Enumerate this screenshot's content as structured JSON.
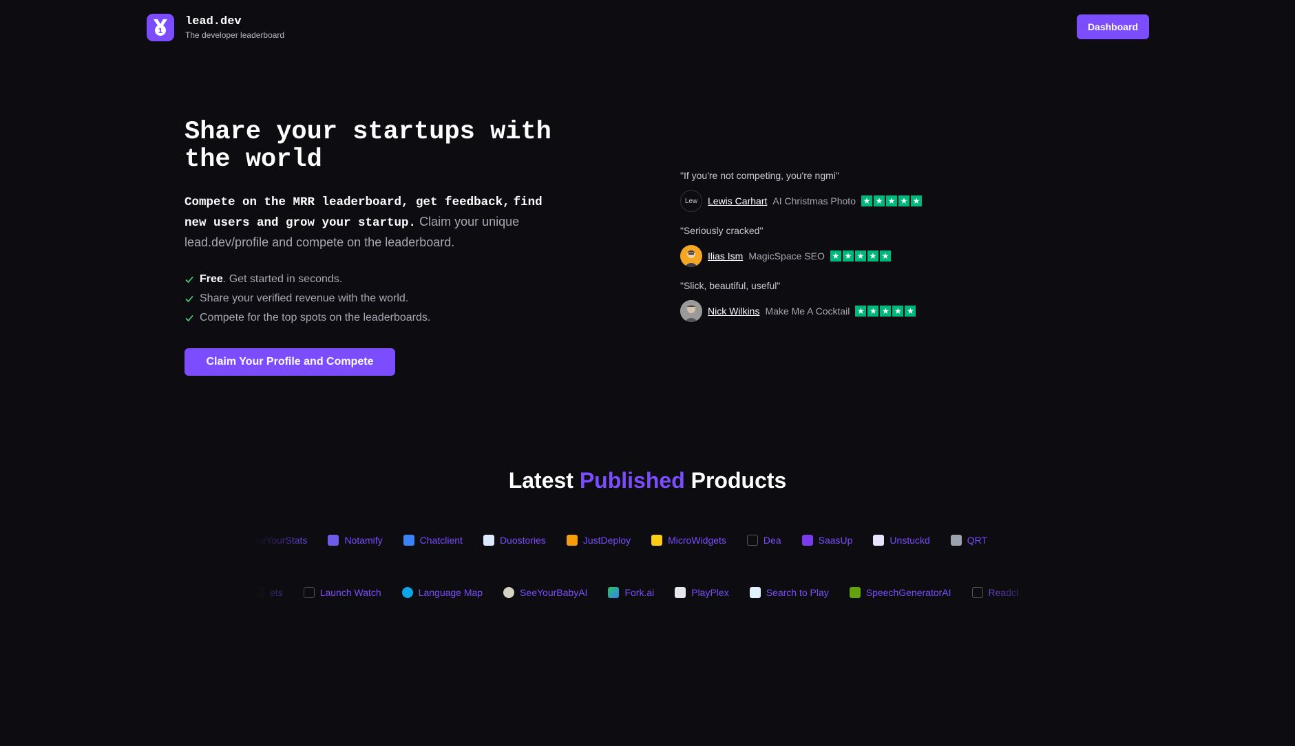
{
  "header": {
    "brand_name": "lead.dev",
    "brand_tagline": "The developer leaderboard",
    "dashboard_label": "Dashboard"
  },
  "hero": {
    "title_line1": "Share your startups with",
    "title_line2": "the world",
    "lead_bold_1": "Compete on the MRR leaderboard, get feedback,",
    "lead_bold_2": "find new users and grow your startup.",
    "lead_rest": " Claim your unique lead.dev/profile and compete on the leaderboard.",
    "checks": [
      {
        "bold": "Free",
        "text": ". Get started in seconds."
      },
      {
        "bold": "",
        "text": "Share your verified revenue with the world."
      },
      {
        "bold": "",
        "text": "Compete for the top spots on the leaderboards."
      }
    ],
    "cta_label": "Claim Your Profile and Compete"
  },
  "testimonials": [
    {
      "quote": "\"If you're not competing, you're ngmi\"",
      "author": "Lewis Carhart",
      "product": "AI Christmas Photo",
      "rating": 5,
      "avatar_alt": "Lew"
    },
    {
      "quote": "\"Seriously cracked\"",
      "author": "Ilias Ism",
      "product": "MagicSpace SEO",
      "rating": 5
    },
    {
      "quote": "\"Slick, beautiful, useful\"",
      "author": "Nick Wilkins",
      "product": "Make Me A Cocktail",
      "rating": 5
    }
  ],
  "latest": {
    "word1": "Latest",
    "word2": "Published",
    "word3": "Products"
  },
  "products_row1": [
    "MakeYourStats",
    "Notamify",
    "Chatclient",
    "Duostories",
    "JustDeploy",
    "MicroWidgets",
    "Dea",
    "SaasUp",
    "Unstuckd",
    "QRT"
  ],
  "products_row2": [
    "ets",
    "Launch Watch",
    "Language Map",
    "SeeYourBabyAI",
    "Fork.ai",
    "PlayPlex",
    "Search to Play",
    "SpeechGeneratorAI",
    "Readcl"
  ],
  "colors": {
    "background": "#0d0c10",
    "accent": "#7c4dff",
    "star_green": "#00b67a",
    "check_green": "#4ade80"
  }
}
